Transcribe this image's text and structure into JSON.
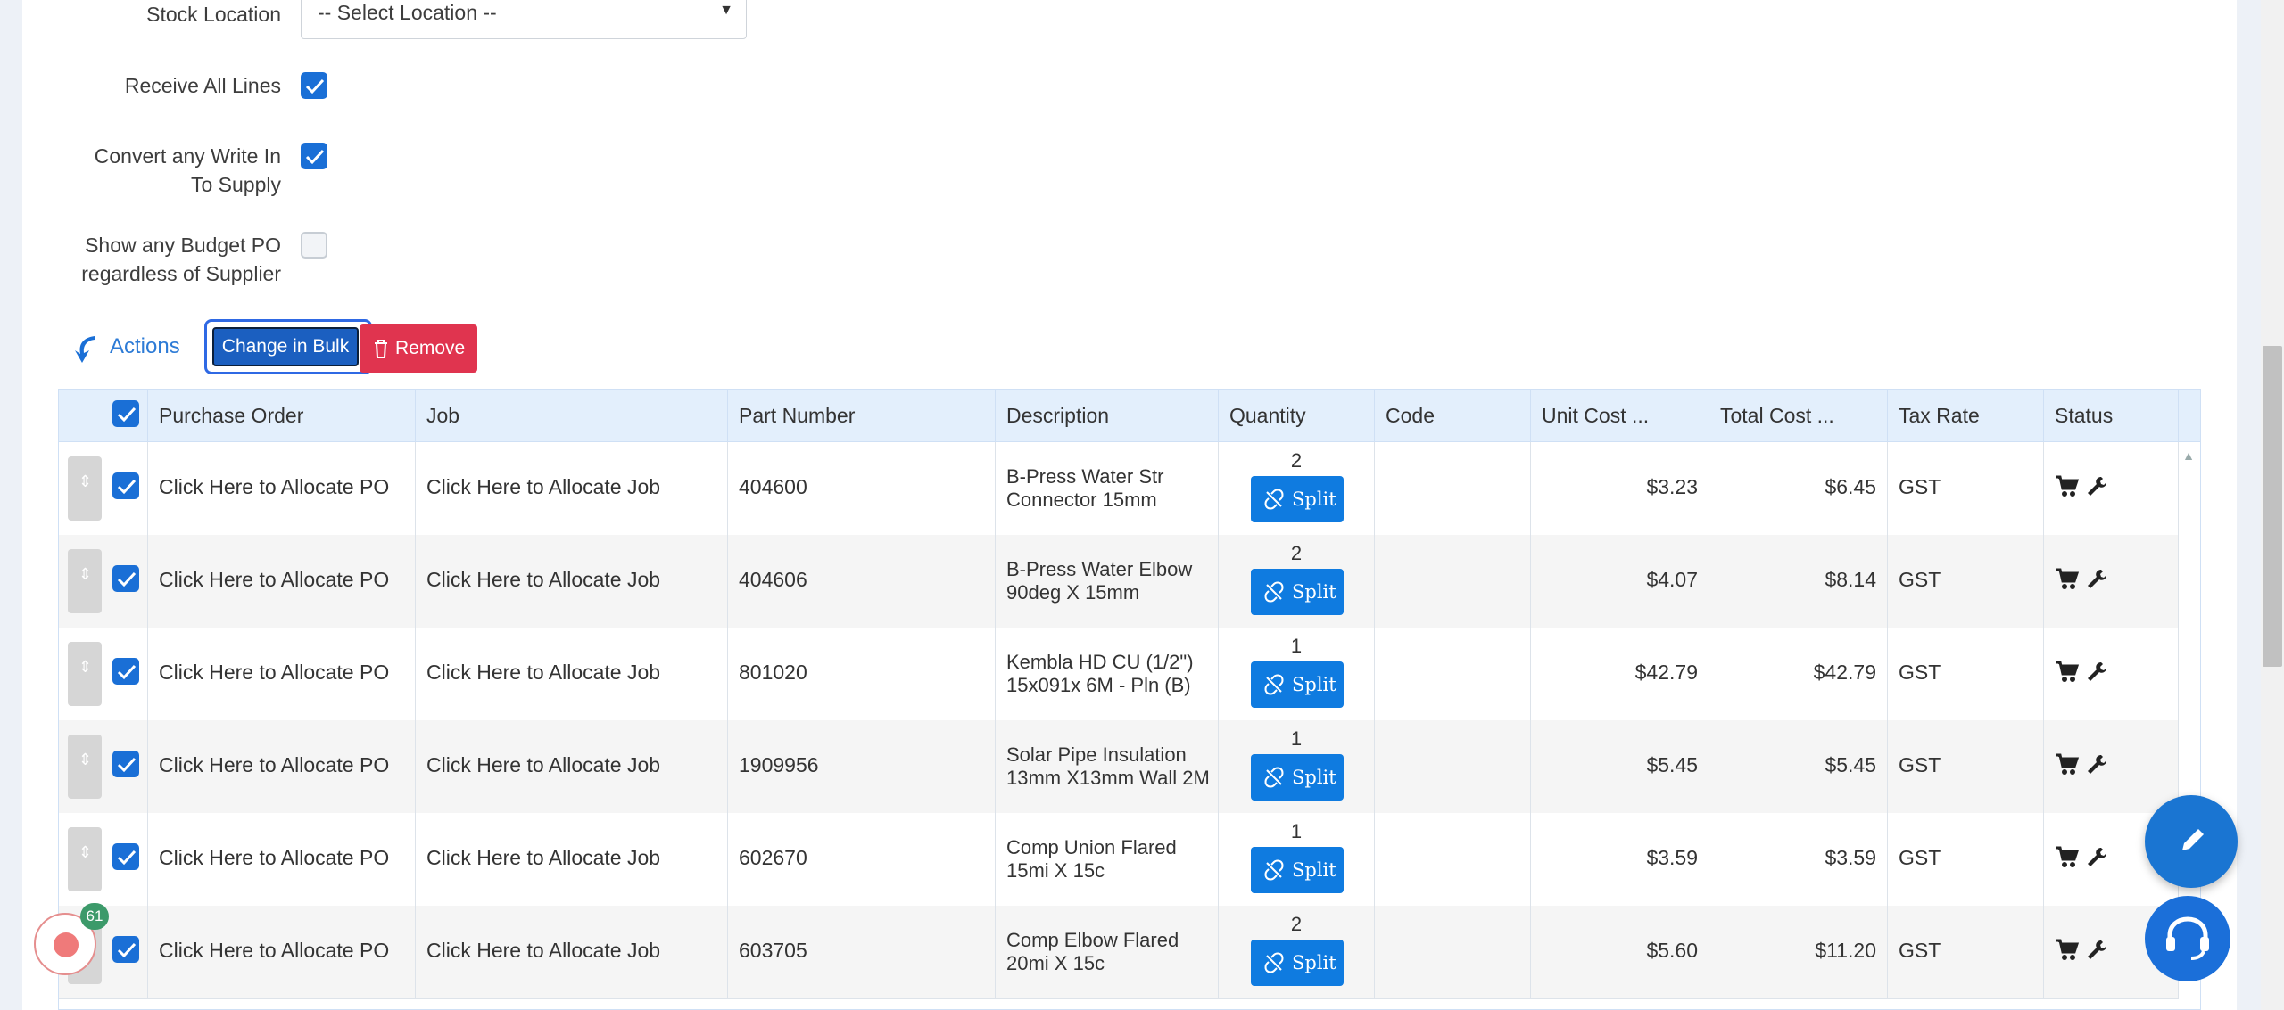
{
  "form": {
    "stock_location_label": "Stock Location",
    "stock_location_value": "-- Select Location --",
    "receive_all_label": "Receive All Lines",
    "receive_all_checked": true,
    "convert_write_in_label_1": "Convert any Write In",
    "convert_write_in_label_2": "To Supply",
    "convert_write_in_checked": true,
    "budget_po_label_1": "Show any Budget PO",
    "budget_po_label_2": "regardless of Supplier",
    "budget_po_checked": false
  },
  "toolbar": {
    "actions_label": "Actions",
    "change_bulk_label": "Change in Bulk",
    "remove_label": "Remove"
  },
  "table": {
    "columns": [
      "Purchase Order",
      "Job",
      "Part Number",
      "Description",
      "Quantity",
      "Code",
      "Unit Cost ...",
      "Total Cost ...",
      "Tax Rate",
      "Status"
    ],
    "split_label": "Split",
    "rows": [
      {
        "po": "Click Here to Allocate PO",
        "job": "Click Here to Allocate Job",
        "part": "404600",
        "desc": "B-Press Water Str Connector 15mm",
        "qty": "2",
        "code": "",
        "unit": "$3.23",
        "total": "$6.45",
        "tax": "GST"
      },
      {
        "po": "Click Here to Allocate PO",
        "job": "Click Here to Allocate Job",
        "part": "404606",
        "desc": "B-Press Water Elbow 90deg X 15mm",
        "qty": "2",
        "code": "",
        "unit": "$4.07",
        "total": "$8.14",
        "tax": "GST"
      },
      {
        "po": "Click Here to Allocate PO",
        "job": "Click Here to Allocate Job",
        "part": "801020",
        "desc": "Kembla HD CU (1/2\") 15x091x 6M - Pln (B)",
        "qty": "1",
        "code": "",
        "unit": "$42.79",
        "total": "$42.79",
        "tax": "GST"
      },
      {
        "po": "Click Here to Allocate PO",
        "job": "Click Here to Allocate Job",
        "part": "1909956",
        "desc": "Solar Pipe Insulation 13mm X13mm Wall 2M",
        "qty": "1",
        "code": "",
        "unit": "$5.45",
        "total": "$5.45",
        "tax": "GST"
      },
      {
        "po": "Click Here to Allocate PO",
        "job": "Click Here to Allocate Job",
        "part": "602670",
        "desc": "Comp Union Flared 15mi X 15c",
        "qty": "1",
        "code": "",
        "unit": "$3.59",
        "total": "$3.59",
        "tax": "GST"
      },
      {
        "po": "Click Here to Allocate PO",
        "job": "Click Here to Allocate Job",
        "part": "603705",
        "desc": "Comp Elbow Flared 20mi X 15c",
        "qty": "2",
        "code": "",
        "unit": "$5.60",
        "total": "$11.20",
        "tax": "GST"
      }
    ]
  },
  "recorder": {
    "badge_count": "61"
  },
  "colors": {
    "primary": "#1a6fd6",
    "danger": "#e0344f",
    "header_bg": "#e3effc"
  }
}
